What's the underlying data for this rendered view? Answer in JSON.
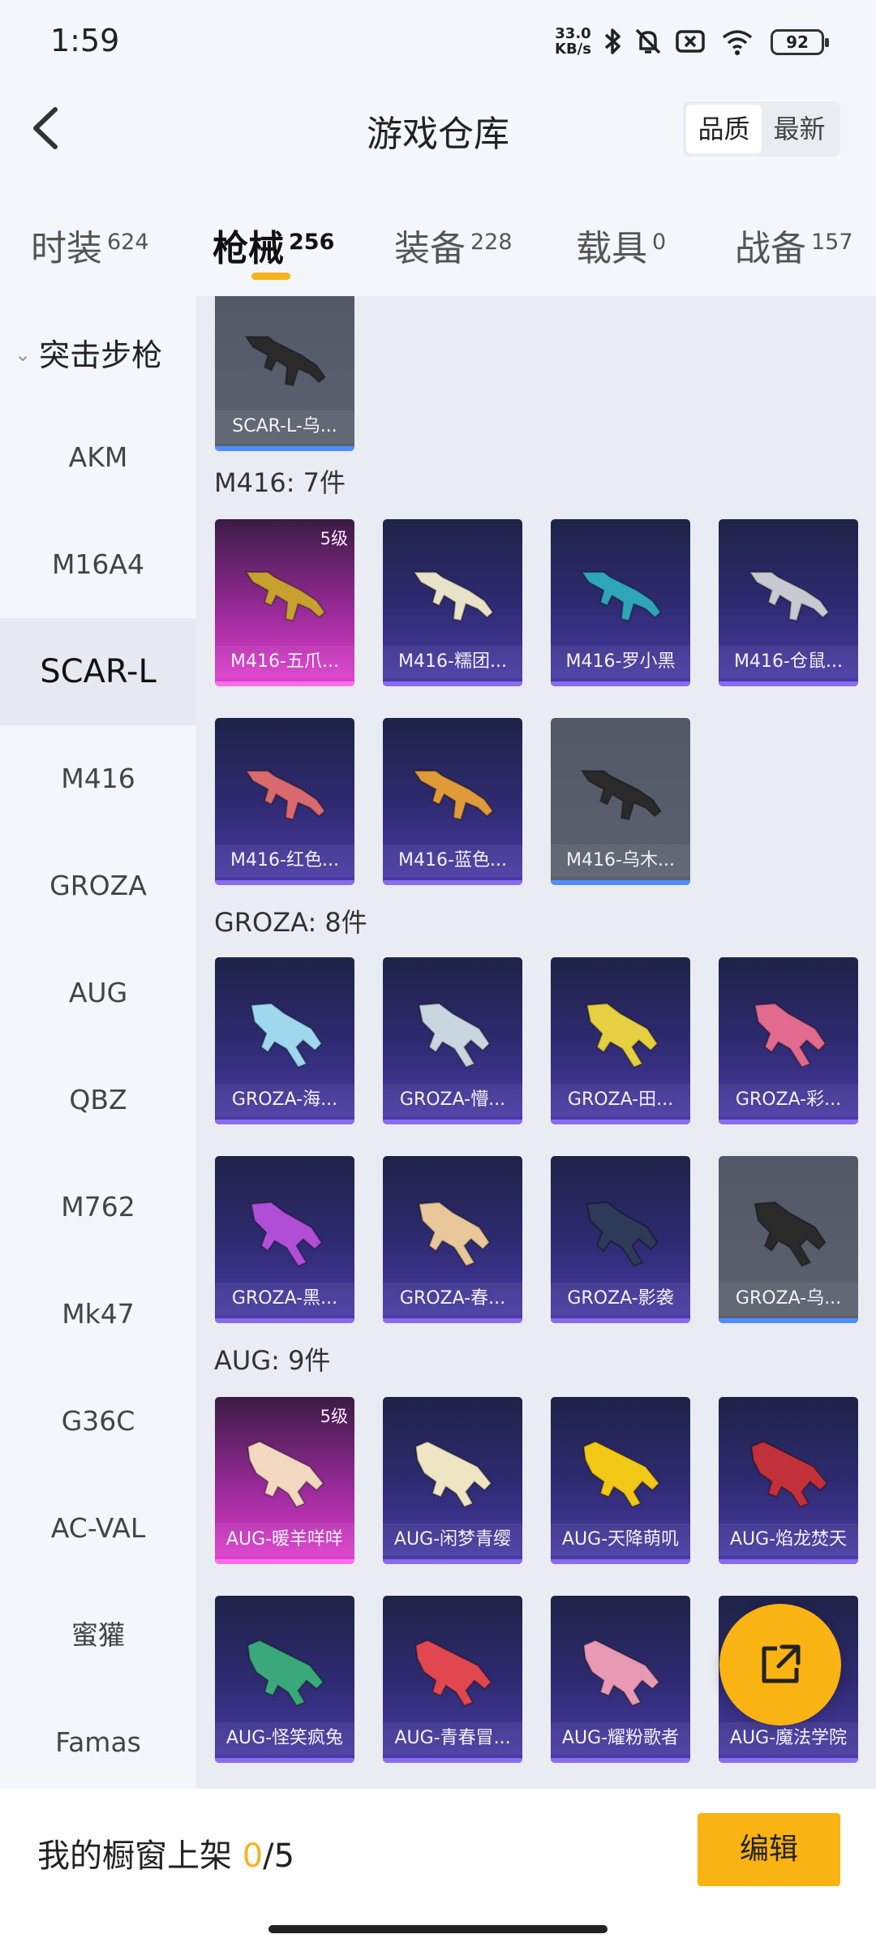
{
  "status_bar": {
    "time": "1:59",
    "net_speed_value": "33.0",
    "net_speed_unit": "KB/s",
    "battery": "92",
    "icons": [
      "bluetooth-icon",
      "bell-off-icon",
      "sim-off-icon",
      "wifi-icon",
      "battery-icon"
    ]
  },
  "header": {
    "title": "游戏仓库",
    "sort_options": [
      "品质",
      "最新"
    ],
    "sort_selected": "品质"
  },
  "categories": [
    {
      "label": "时装",
      "count": "624"
    },
    {
      "label": "枪械",
      "count": "256"
    },
    {
      "label": "装备",
      "count": "228"
    },
    {
      "label": "载具",
      "count": "0"
    },
    {
      "label": "战备",
      "count": "157"
    }
  ],
  "category_selected": "枪械",
  "sidebar": {
    "group": "突击步枪",
    "items": [
      "AKM",
      "M16A4",
      "SCAR-L",
      "M416",
      "GROZA",
      "AUG",
      "QBZ",
      "M762",
      "Mk47",
      "G36C",
      "AC-VAL",
      "蜜獾",
      "Famas"
    ],
    "selected": "SCAR-L"
  },
  "sections": [
    {
      "title": "",
      "items": [
        {
          "name": "SCAR-L-乌...",
          "tier": "grey",
          "accent": "#2a2a2a"
        }
      ]
    },
    {
      "title": "M416: 7件",
      "items": [
        {
          "name": "M416-五爪...",
          "tier": "gold",
          "level": "5级",
          "accent": "#c8a030"
        },
        {
          "name": "M416-糯团...",
          "tier": "purple",
          "accent": "#e8e2c8"
        },
        {
          "name": "M416-罗小黑",
          "tier": "purple",
          "accent": "#2fa6b8"
        },
        {
          "name": "M416-仓鼠...",
          "tier": "purple",
          "accent": "#c9c9d2"
        },
        {
          "name": "M416-红色...",
          "tier": "purple",
          "accent": "#d86a70"
        },
        {
          "name": "M416-蓝色...",
          "tier": "purple",
          "accent": "#e09a3a"
        },
        {
          "name": "M416-乌木...",
          "tier": "grey",
          "accent": "#2a2a2a"
        }
      ]
    },
    {
      "title": "GROZA: 8件",
      "items": [
        {
          "name": "GROZA-海...",
          "tier": "purple",
          "accent": "#9fd8ee"
        },
        {
          "name": "GROZA-懵...",
          "tier": "purple",
          "accent": "#c9d6e0"
        },
        {
          "name": "GROZA-田...",
          "tier": "purple",
          "accent": "#e6d042"
        },
        {
          "name": "GROZA-彩...",
          "tier": "purple",
          "accent": "#e26a8e"
        },
        {
          "name": "GROZA-黑...",
          "tier": "purple",
          "accent": "#b04fd6"
        },
        {
          "name": "GROZA-春...",
          "tier": "purple",
          "accent": "#e8c79a"
        },
        {
          "name": "GROZA-影袭",
          "tier": "purple",
          "accent": "#2d3a5a"
        },
        {
          "name": "GROZA-乌...",
          "tier": "grey",
          "accent": "#2a2a2a"
        }
      ]
    },
    {
      "title": "AUG: 9件",
      "items": [
        {
          "name": "AUG-暖羊咩咩",
          "tier": "gold",
          "level": "5级",
          "accent": "#f3d8c0"
        },
        {
          "name": "AUG-闲梦青缨",
          "tier": "purple",
          "accent": "#efe5c2"
        },
        {
          "name": "AUG-天降萌叽",
          "tier": "purple",
          "accent": "#f2c817"
        },
        {
          "name": "AUG-焰龙焚天",
          "tier": "purple",
          "accent": "#c2303a"
        },
        {
          "name": "AUG-怪笑疯兔",
          "tier": "purple",
          "accent": "#3aa87a"
        },
        {
          "name": "AUG-青春冒...",
          "tier": "purple",
          "accent": "#e0474f"
        },
        {
          "name": "AUG-耀粉歌者",
          "tier": "purple",
          "accent": "#e89ab5"
        },
        {
          "name": "AUG-魔法学院",
          "tier": "purple",
          "accent": "#3a6fb0"
        }
      ]
    }
  ],
  "showcase": {
    "label": "我的橱窗上架",
    "current": "0",
    "total": "/5"
  },
  "edit_label": "编辑",
  "colors": {
    "accent": "#f9b312",
    "tab_indicator": "#f8b21b",
    "purple_tier": "#4a3ca8",
    "gold_tier": "#e23fd0",
    "grey_tier": "#5b616d"
  }
}
